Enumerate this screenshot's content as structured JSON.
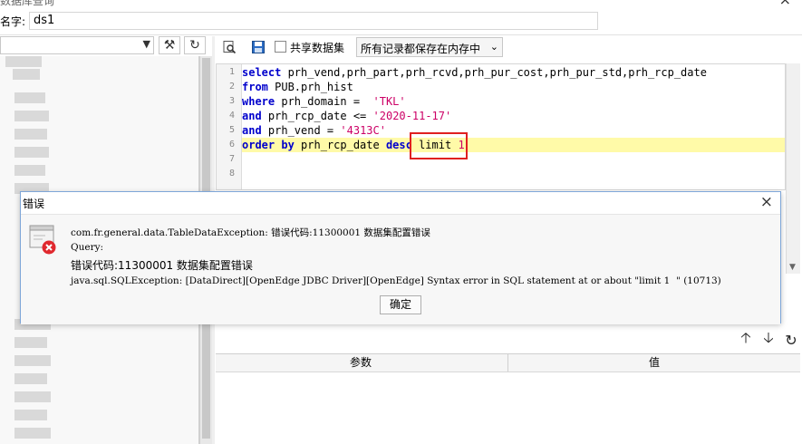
{
  "window": {
    "title": "数据库查询",
    "close_glyph": "×"
  },
  "name_field": {
    "label": "名字:",
    "value": "ds1"
  },
  "left_panel": {
    "connection_value": ""
  },
  "toolbar": {
    "share_dataset_label": "共享数据集",
    "share_dataset_checked": false,
    "record_mode_value": "所有记录都保存在内存中"
  },
  "editor": {
    "line_numbers": [
      "1",
      "2",
      "3",
      "4",
      "5",
      "6",
      "7",
      "8"
    ],
    "lines": [
      [
        {
          "t": "select",
          "c": "kw"
        },
        {
          "t": " prh_vend,prh_part,prh_rcvd,prh_pur_cost,prh_pur_std,prh_rcp_date",
          "c": "plain"
        }
      ],
      [
        {
          "t": "from",
          "c": "kw"
        },
        {
          "t": " PUB.prh_hist",
          "c": "plain"
        }
      ],
      [
        {
          "t": "where",
          "c": "kw"
        },
        {
          "t": " prh_domain =  ",
          "c": "plain"
        },
        {
          "t": "'TKL'",
          "c": "str"
        }
      ],
      [
        {
          "t": "and",
          "c": "kw"
        },
        {
          "t": " prh_rcp_date <= ",
          "c": "plain"
        },
        {
          "t": "'2020-11-17'",
          "c": "str"
        }
      ],
      [
        {
          "t": "and",
          "c": "kw"
        },
        {
          "t": " prh_vend = ",
          "c": "plain"
        },
        {
          "t": "'4313C'",
          "c": "str"
        }
      ],
      [
        {
          "t": "order by",
          "c": "kw"
        },
        {
          "t": " prh_rcp_date ",
          "c": "plain"
        },
        {
          "t": "desc",
          "c": "kw"
        },
        {
          "t": " limit ",
          "c": "plain"
        },
        {
          "t": "1",
          "c": "num"
        }
      ],
      [],
      []
    ],
    "highlighted_line": 6
  },
  "error_dialog": {
    "title": "错误",
    "close_glyph": "×",
    "line1": "com.fr.general.data.TableDataException: 错误代码:11300001 数据集配置错误",
    "line2": "Query:",
    "line3": "错误代码:11300001 数据集配置错误",
    "line4": "java.sql.SQLException: [DataDirect][OpenEdge JDBC Driver][OpenEdge] Syntax error in SQL statement at or about \"limit 1  \" (10713)",
    "ok_label": "确定"
  },
  "param_actions": {
    "up_glyph": "🡡",
    "down_glyph": "🡣",
    "refresh_glyph": "↻"
  },
  "params_table": {
    "columns": [
      "参数",
      "值"
    ]
  },
  "colors": {
    "keyword": "#0000cc",
    "string": "#cc0066",
    "highlight": "#fffaa8",
    "annotation": "#e02020"
  }
}
